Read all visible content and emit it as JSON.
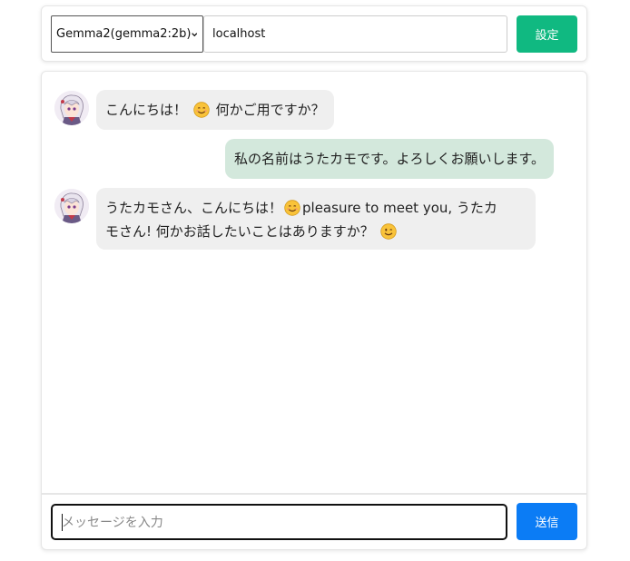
{
  "settings": {
    "model_selected": "Gemma2(gemma2:2b)",
    "host_value": "localhost",
    "save_label": "設定"
  },
  "messages": [
    {
      "role": "assistant",
      "text_before": "こんにちは！",
      "emoji1": "smiling-face-icon",
      "text_after": "何かご用ですか？"
    },
    {
      "role": "user",
      "text": "私の名前はうたカモです。よろしくお願いします。"
    },
    {
      "role": "assistant",
      "line1_a": "うたカモさん、こんにちは！",
      "emoji1": "smiling-face-icon",
      "line1_b": "pleasure to meet you, うたカ",
      "line2_a": "モさん! 何かお話したいことはありますか？",
      "emoji2": "winking-face-icon"
    }
  ],
  "composer": {
    "placeholder": "メッセージを入力",
    "send_label": "送信"
  },
  "colors": {
    "save_button": "#10b981",
    "send_button": "#0b7cf5",
    "user_bubble": "#d3e8dc",
    "assistant_bubble": "#efefef"
  }
}
